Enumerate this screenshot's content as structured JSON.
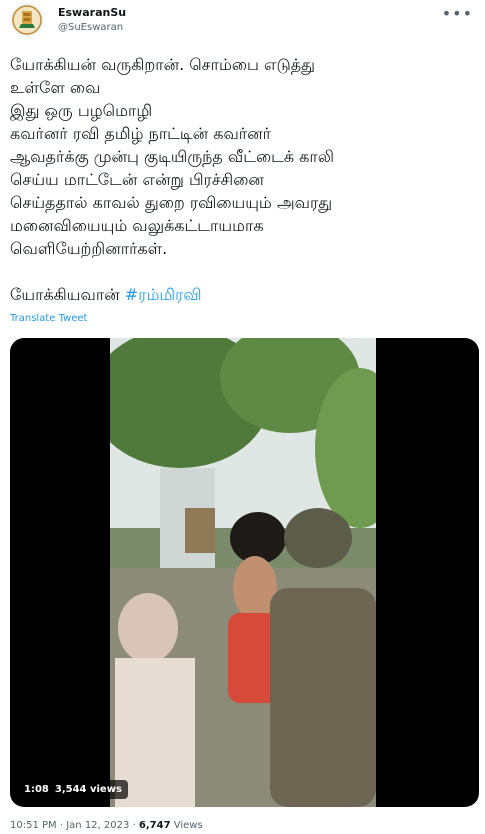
{
  "author": {
    "display_name": "EswaranSu",
    "handle": "@SuEswaran",
    "avatar_icon": "tamil-nadu-emblem-icon"
  },
  "tweet": {
    "lines": [
      "யோக்கியன் வருகிறான். சொம்பை எடுத்து",
      "உள்ளே வை",
      "இது ஒரு பழமொழி",
      "கவர்னர் ரவி தமிழ் நாட்டின் கவர்னர்",
      "ஆவதர்க்கு முன்பு குடியிருந்த வீட்டைக் காலி",
      "செய்ய மாட்டேன் என்று பிரச்சினை",
      "செய்ததால் காவல் துறை ரவியையும் அவரது",
      "மனைவியையும் வலுக்கட்டாயமாக",
      "வெளியேற்றினார்கள்."
    ],
    "closing_text": "யோக்கியவான் ",
    "hashtag": "#ரம்மிரவி",
    "translate_label": "Translate Tweet",
    "more_icon": "more-dots-icon"
  },
  "video": {
    "duration": "1:08",
    "views": "3,544 views"
  },
  "meta": {
    "time": "10:51 PM",
    "date": "Jan 12, 2023",
    "views_count": "6,747",
    "views_label": "Views"
  },
  "colors": {
    "link": "#1d9bf0",
    "text": "#0f1419",
    "muted": "#536471"
  }
}
